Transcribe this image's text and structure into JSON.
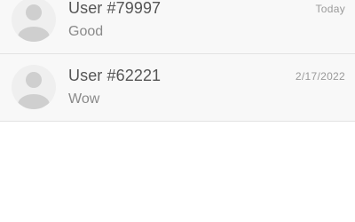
{
  "conversations": [
    {
      "name": "User #79997",
      "preview": "Good",
      "date": "Today",
      "avatar_icon": "default-user-avatar-icon"
    },
    {
      "name": "User #62221",
      "preview": "Wow",
      "date": "2/17/2022",
      "avatar_icon": "default-user-avatar-icon"
    }
  ],
  "colors": {
    "row_background": "#f8f8f8",
    "divider": "#e3e3e3",
    "avatar_background": "#efefef",
    "avatar_figure": "#cfcfcf",
    "name_text": "#555555",
    "preview_text": "#8a8a8a",
    "date_text": "#9a9a9a"
  }
}
